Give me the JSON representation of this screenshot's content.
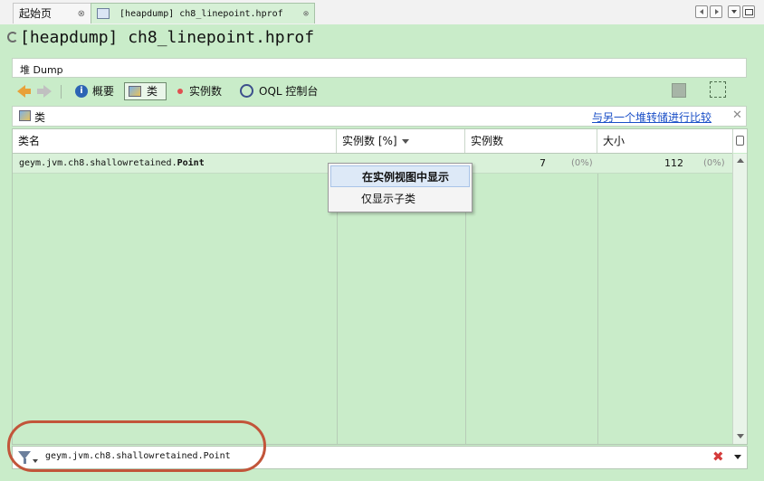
{
  "tabs": [
    {
      "label": "起始页",
      "close": "⊗"
    },
    {
      "label": "[heapdump] ch8_linepoint.hprof",
      "close": "⊗"
    }
  ],
  "document": {
    "title": "[heapdump] ch8_linepoint.hprof",
    "breadcrumb": "堆 Dump"
  },
  "toolbar": {
    "summary": "概要",
    "classes": "类",
    "instances": "实例数",
    "oql": "OQL 控制台"
  },
  "section": {
    "title": "类",
    "compare_link": "与另一个堆转储进行比较",
    "close": "✕"
  },
  "table": {
    "headers": {
      "name": "类名",
      "instances_pct": "实例数 [%]",
      "instances": "实例数",
      "size": "大小"
    },
    "rows": [
      {
        "name_prefix": "geym.jvm.ch8.shallowretained.",
        "name_class": "Point",
        "instances": "7",
        "instances_pct": "(0%)",
        "size": "112",
        "size_pct": "(0%)"
      }
    ]
  },
  "context_menu": {
    "items": [
      "在实例视图中显示",
      "仅显示子类"
    ]
  },
  "filter": {
    "value": "geym.jvm.ch8.shallowretained.Point",
    "clear": "✖"
  },
  "colors": {
    "panel": "#c9ecc9",
    "highlight_ring": "#c2553a",
    "link": "#1a4fc7"
  }
}
